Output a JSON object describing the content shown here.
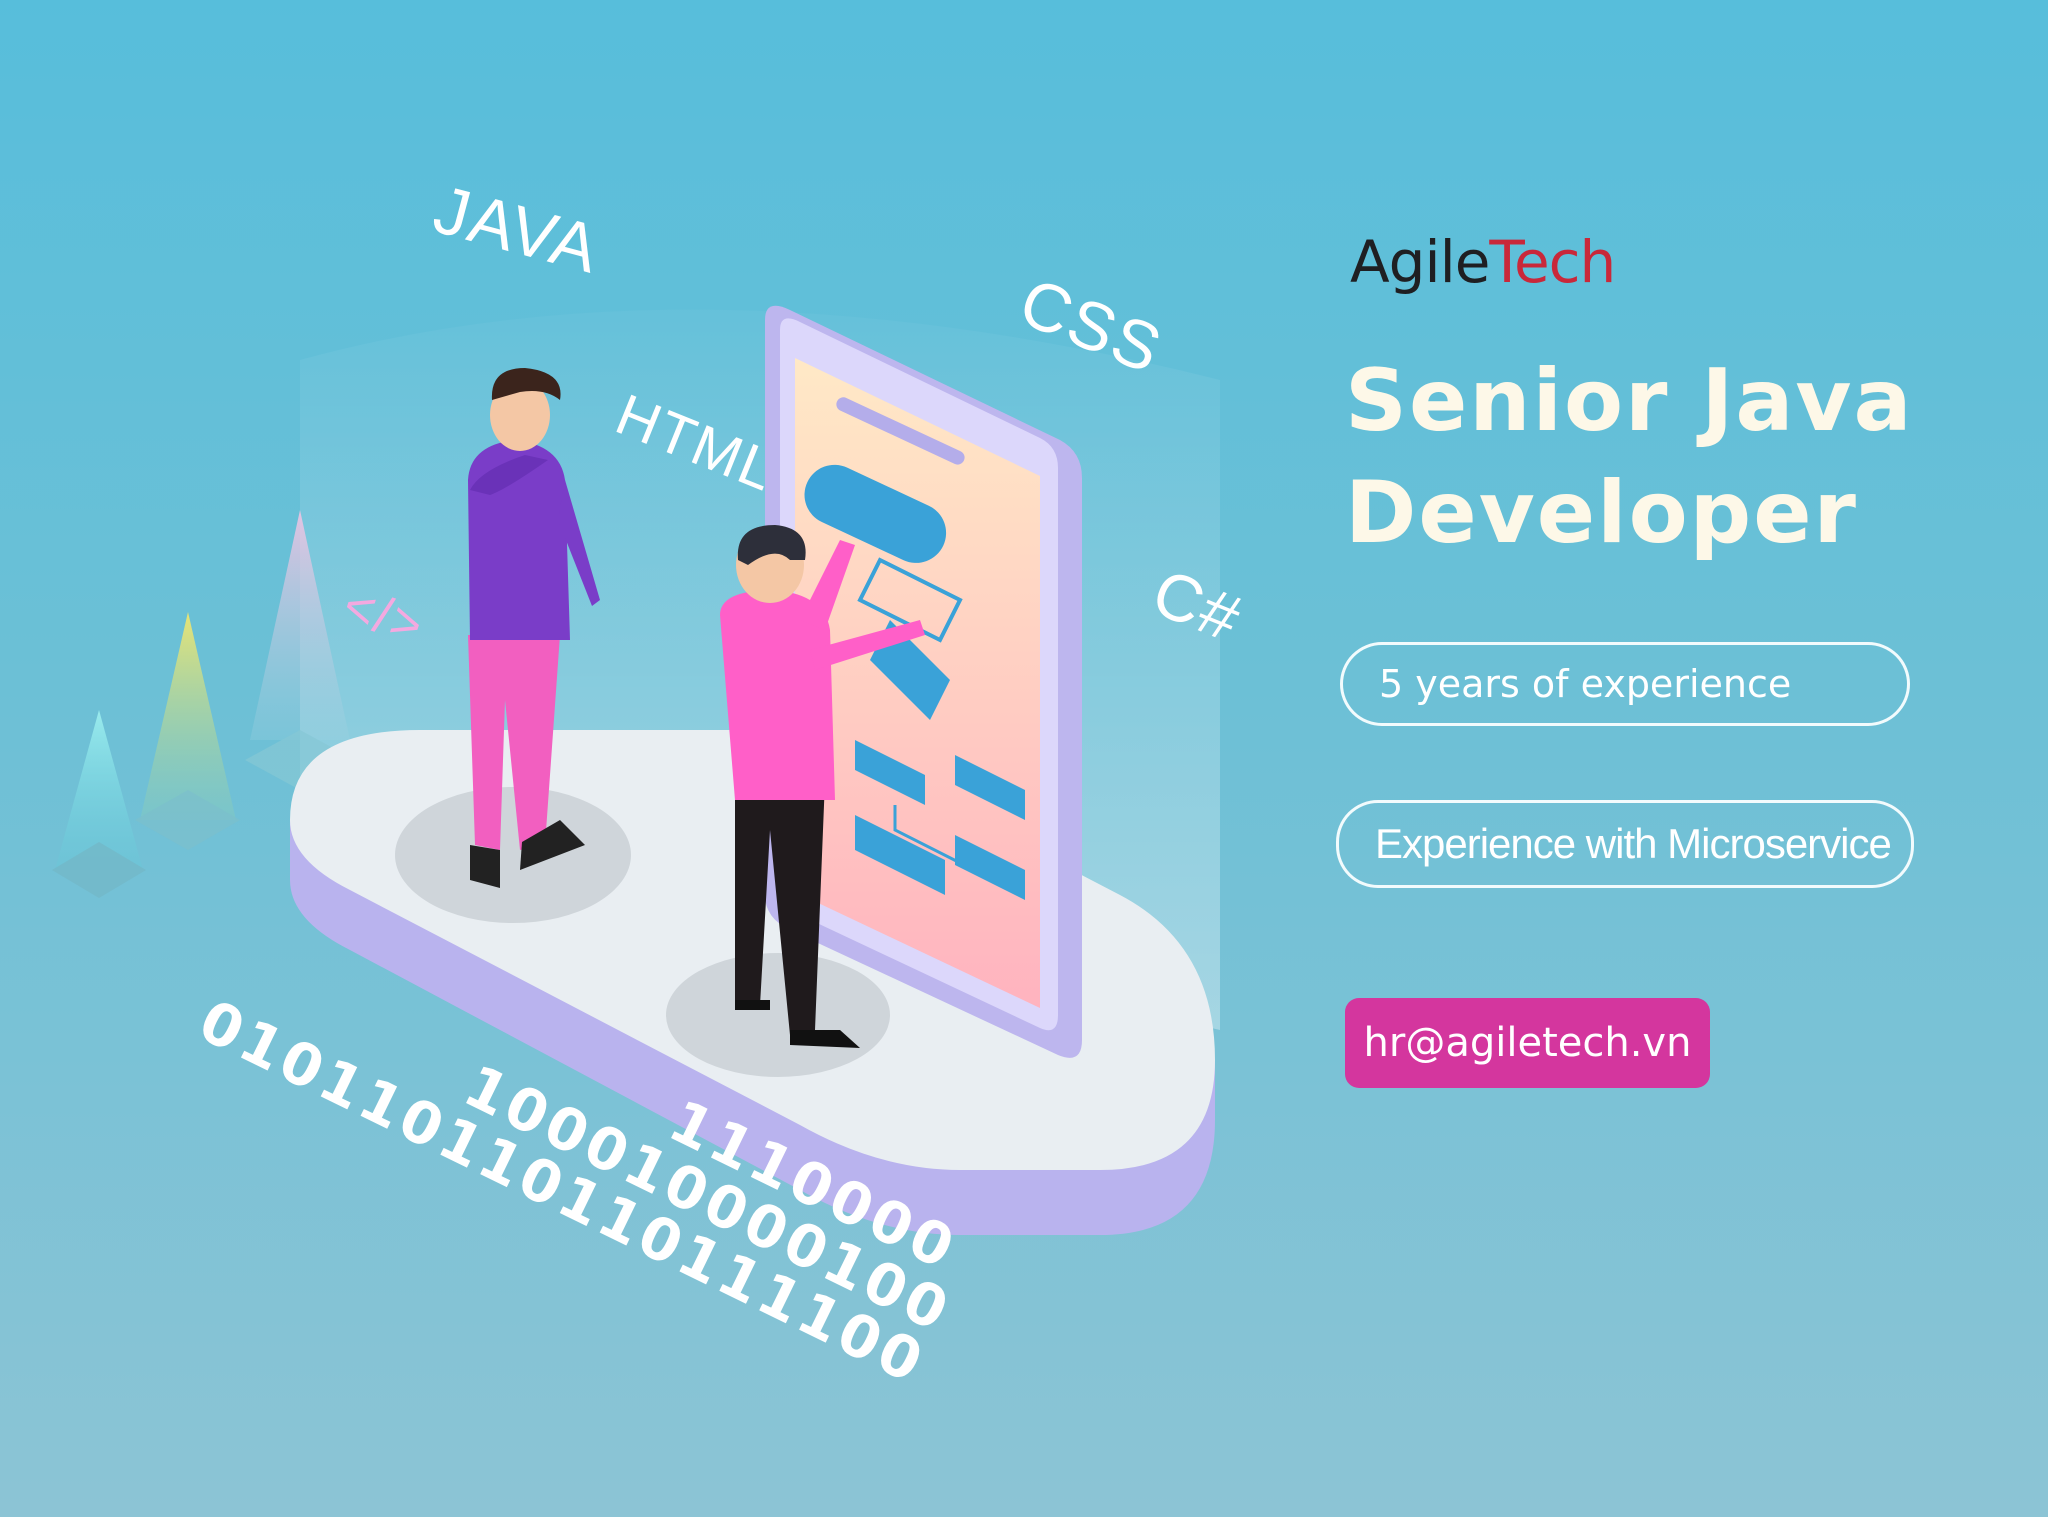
{
  "logo": {
    "part1": "Agile",
    "part2": "Tech"
  },
  "title": {
    "line1": "Senior Java",
    "line2": "Developer"
  },
  "requirements": [
    {
      "label": "5 years of experience"
    },
    {
      "label": "Experience with Microservice"
    }
  ],
  "contact": {
    "email": "hr@agiletech.vn"
  },
  "illustration": {
    "tech_labels": {
      "java": "JAVA",
      "html": "HTML",
      "css": "CSS",
      "csharp": "C#",
      "code_tag": "</>"
    },
    "binary_rows": [
      "010110110110111100",
      "100010000100",
      "1110000"
    ]
  },
  "colors": {
    "background": "#57bedb",
    "accent": "#d4369e",
    "brand_red": "#c9283a",
    "title": "#fdf8e8"
  }
}
